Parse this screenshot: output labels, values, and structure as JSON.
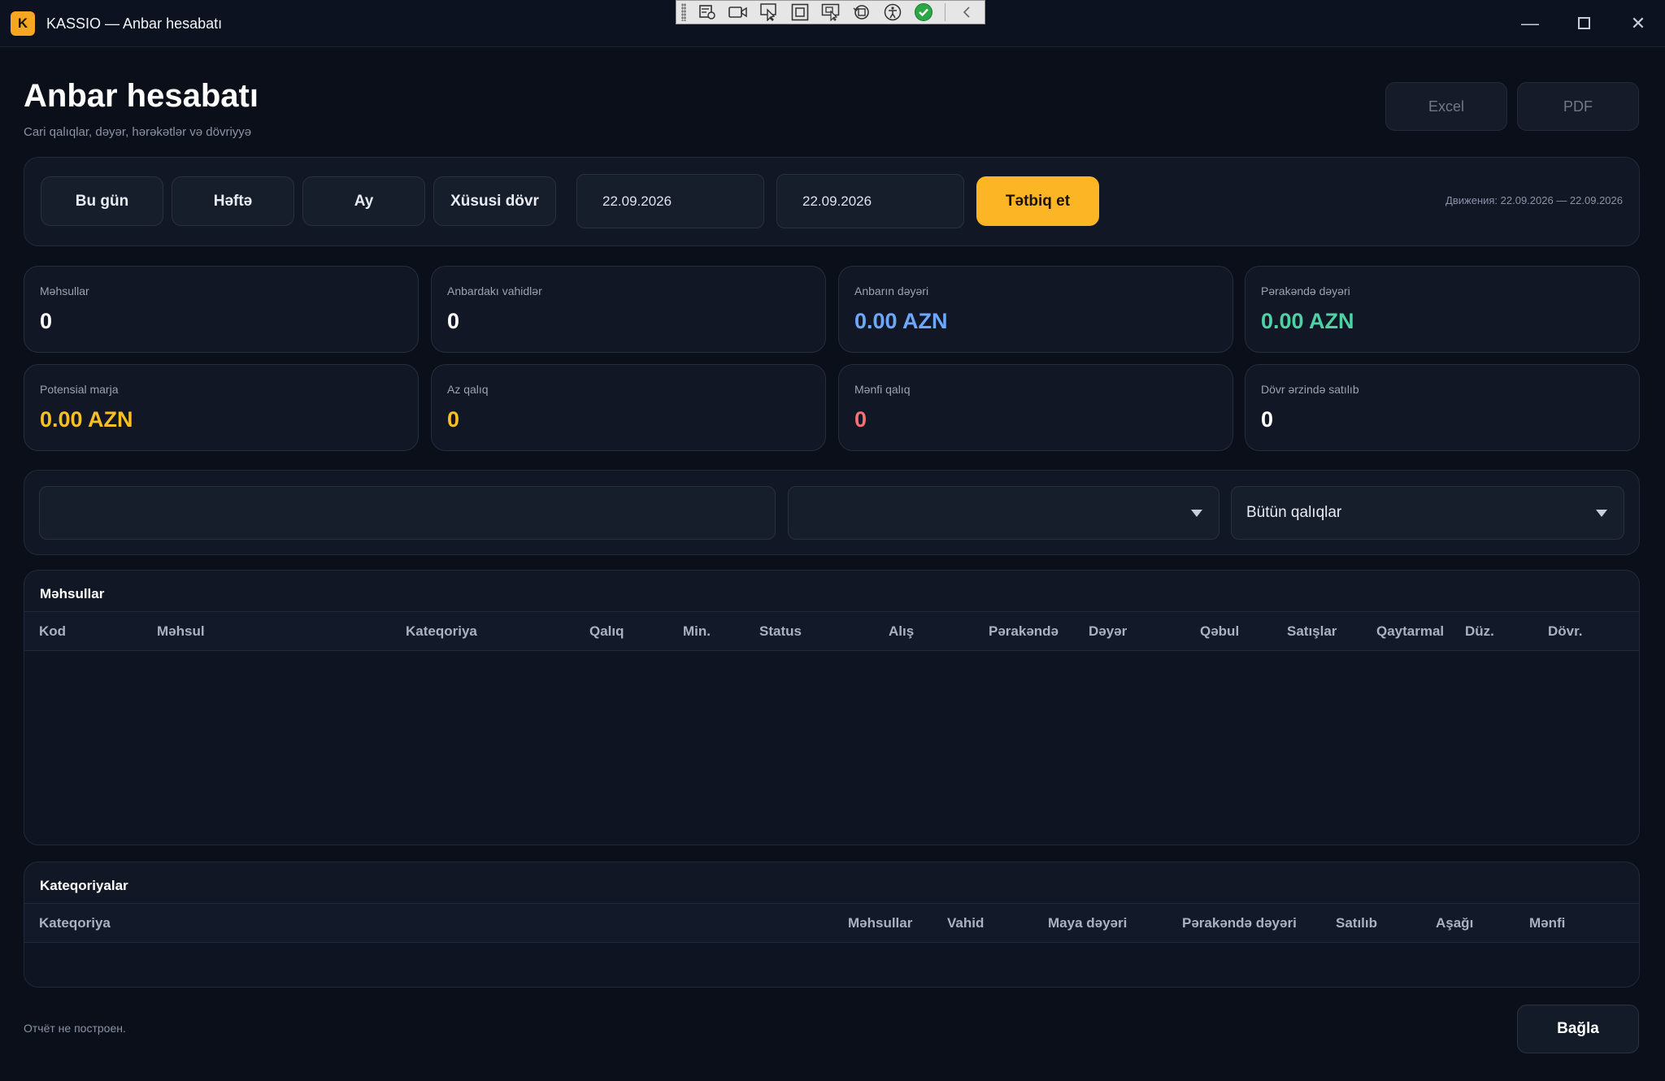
{
  "window": {
    "logo_letter": "K",
    "title": "KASSIO — Anbar hesabatı",
    "minimize": "—",
    "close": "✕"
  },
  "header": {
    "title": "Anbar hesabatı",
    "subtitle": "Cari qalıqlar, dəyər, hərəkətlər və dövriyyə",
    "excel_label": "Excel",
    "pdf_label": "PDF"
  },
  "period": {
    "today_label": "Bu gün",
    "week_label": "Həftə",
    "month_label": "Ay",
    "custom_label": "Xüsusi dövr",
    "date_from": "22.09.2026",
    "date_to": "22.09.2026",
    "apply_label": "Tətbiq et",
    "info": "Движения: 22.09.2026 — 22.09.2026"
  },
  "stats": [
    {
      "label": "Məhsullar",
      "value": "0",
      "color": "#ffffff"
    },
    {
      "label": "Anbardakı vahidlər",
      "value": "0",
      "color": "#ffffff"
    },
    {
      "label": "Anbarın dəyəri",
      "value": "0.00 AZN",
      "color": "#6ea8fe"
    },
    {
      "label": "Pərakəndə dəyəri",
      "value": "0.00 AZN",
      "color": "#4fd1a5"
    },
    {
      "label": "Potensial marja",
      "value": "0.00 AZN",
      "color": "#fbbf24"
    },
    {
      "label": "Az qalıq",
      "value": "0",
      "color": "#fbbf24"
    },
    {
      "label": "Mənfi qalıq",
      "value": "0",
      "color": "#f87171"
    },
    {
      "label": "Dövr ərzində satılıb",
      "value": "0",
      "color": "#ffffff"
    }
  ],
  "filters": {
    "search_placeholder": "",
    "category_value": "",
    "stock_value": "Bütün qalıqlar"
  },
  "products_table": {
    "title": "Məhsullar",
    "columns": [
      "Kod",
      "Məhsul",
      "Kateqoriya",
      "Qalıq",
      "Min.",
      "Status",
      "Alış",
      "Pərakəndə",
      "Dəyər",
      "Qəbul",
      "Satışlar",
      "Qaytarmal",
      "Düz.",
      "Dövr."
    ],
    "rows": []
  },
  "categories_table": {
    "title": "Kateqoriyalar",
    "columns": [
      "Kateqoriya",
      "Məhsullar",
      "Vahid",
      "Maya dəyəri",
      "Pərakəndə dəyəri",
      "Satılıb",
      "Aşağı",
      "Mənfi"
    ],
    "rows": []
  },
  "footer": {
    "status": "Отчёт не построен.",
    "close_label": "Bağla"
  },
  "colors": {
    "accent": "#fbb525",
    "background": "#0b0f19",
    "panel": "#111725"
  }
}
